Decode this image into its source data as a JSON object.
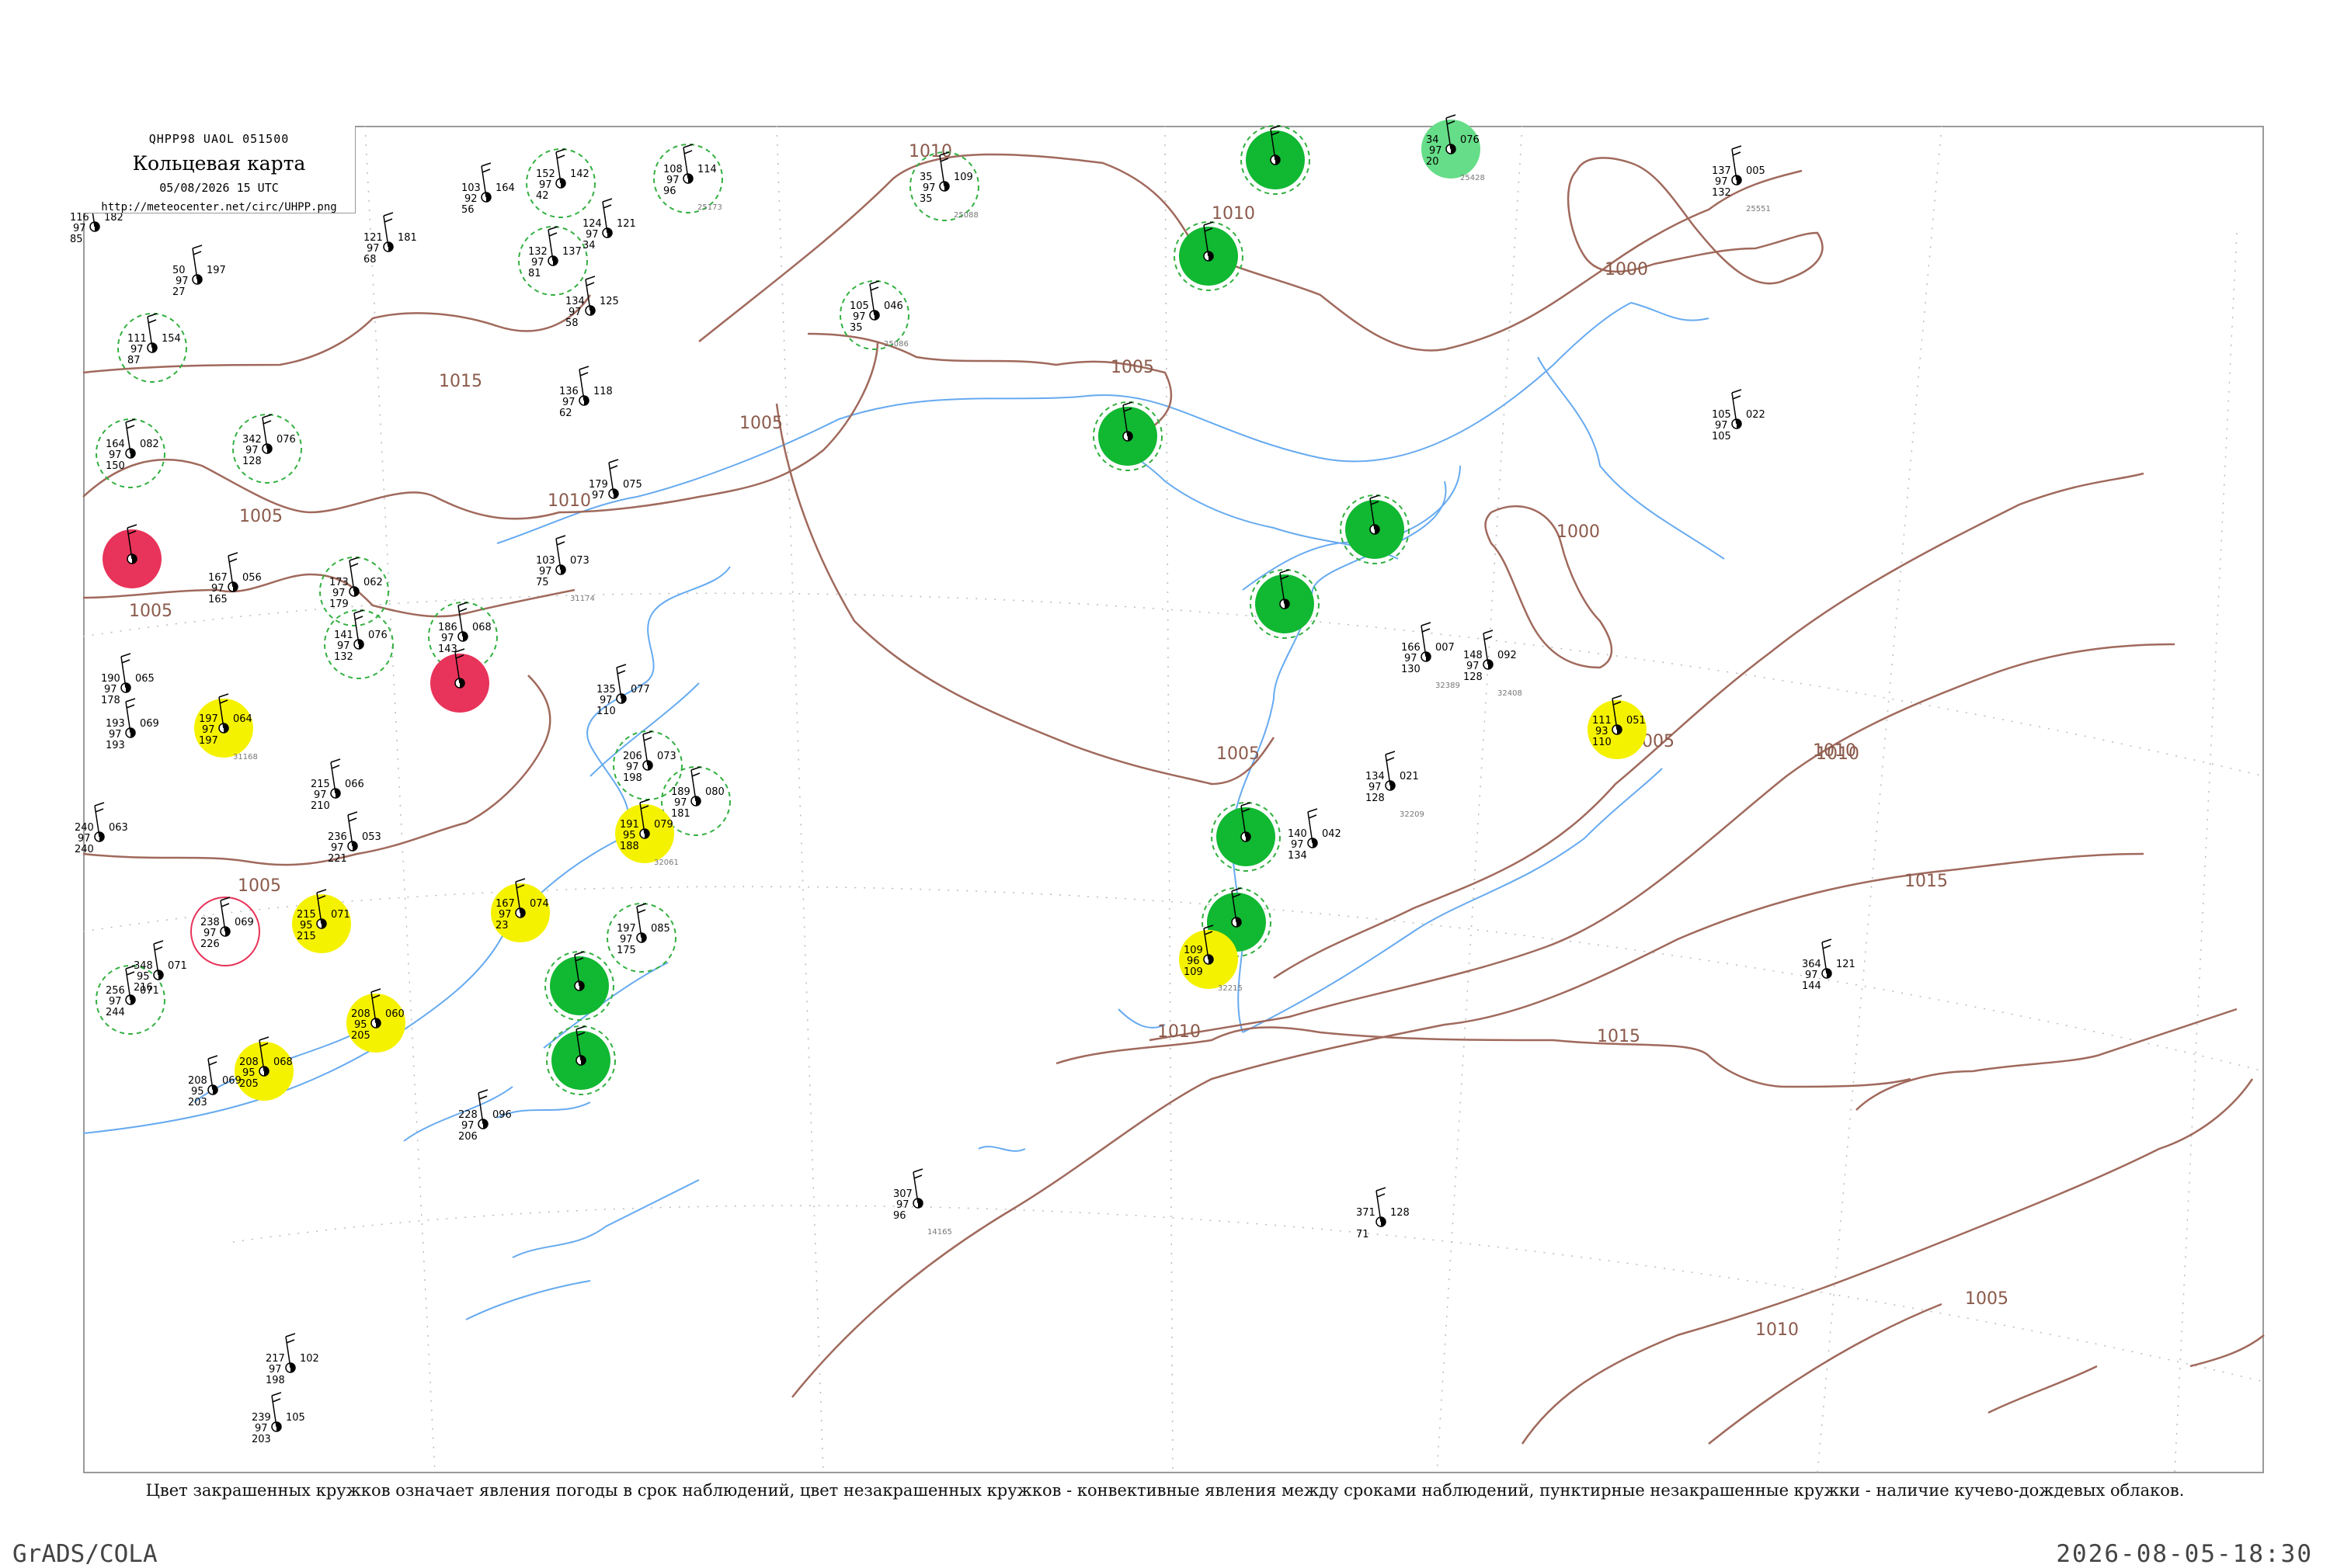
{
  "header": {
    "code": "QHPP98  UAOL  051500",
    "title": "Кольцевая карта",
    "date": "05/08/2026 15 UTC",
    "url": "http://meteocenter.net/circ/UHPP.png"
  },
  "isobars": [
    {
      "label": "1010"
    },
    {
      "label": "1010"
    },
    {
      "label": "1015"
    },
    {
      "label": "1005"
    },
    {
      "label": "1005"
    },
    {
      "label": "1005"
    },
    {
      "label": "1010"
    },
    {
      "label": "1005"
    },
    {
      "label": "1000"
    },
    {
      "label": "1000"
    },
    {
      "label": "1005"
    },
    {
      "label": "1010"
    },
    {
      "label": "1010"
    },
    {
      "label": "1015"
    },
    {
      "label": "1015"
    },
    {
      "label": "1005"
    },
    {
      "label": "1005"
    },
    {
      "label": "1010"
    },
    {
      "label": "1010"
    },
    {
      "label": "1005"
    }
  ],
  "stations": [
    {
      "pressure": "108",
      "temp": "97",
      "dew": "96",
      "extra": "114",
      "id": "25173",
      "circle": "dashed-green"
    },
    {
      "pressure": "35",
      "temp": "97",
      "dew": "35",
      "extra": "109",
      "id": "25088",
      "circle": "dashed-green"
    },
    {
      "pressure": "34",
      "temp": "97",
      "dew": "20",
      "extra": "076",
      "id": "25428",
      "circle": "light-green"
    },
    {
      "pressure": "137",
      "temp": "97",
      "dew": "132",
      "extra": "005",
      "id": "25551",
      "circle": "none"
    },
    {
      "pressure": "105",
      "temp": "97",
      "dew": "35",
      "extra": "046",
      "id": "25086",
      "circle": "dashed-green"
    },
    {
      "pressure": "132",
      "temp": "97",
      "dew": "81",
      "extra": "137",
      "id": "",
      "circle": "dashed-green"
    },
    {
      "pressure": "152",
      "temp": "97",
      "dew": "42",
      "extra": "142",
      "id": "",
      "circle": "dashed-green"
    },
    {
      "pressure": "111",
      "temp": "97",
      "dew": "87",
      "extra": "154",
      "id": "",
      "circle": "dashed-green"
    },
    {
      "pressure": "164",
      "temp": "97",
      "dew": "150",
      "extra": "082",
      "id": "",
      "circle": "dashed-green"
    },
    {
      "pressure": "342",
      "temp": "97",
      "dew": "128",
      "extra": "076",
      "id": "",
      "circle": "dashed-green"
    },
    {
      "pressure": "",
      "temp": "",
      "dew": "",
      "extra": "",
      "id": "",
      "circle": "red"
    },
    {
      "pressure": "173",
      "temp": "97",
      "dew": "179",
      "extra": "062",
      "id": "",
      "circle": "dashed-green"
    },
    {
      "pressure": "141",
      "temp": "97",
      "dew": "132",
      "extra": "076",
      "id": "",
      "circle": "dashed-green"
    },
    {
      "pressure": "186",
      "temp": "97",
      "dew": "143",
      "extra": "068",
      "id": "",
      "circle": "dashed-green"
    },
    {
      "pressure": "",
      "temp": "",
      "dew": "",
      "extra": "",
      "id": "",
      "circle": "red"
    },
    {
      "pressure": "197",
      "temp": "97",
      "dew": "197",
      "extra": "064",
      "id": "31168",
      "circle": "yellow"
    },
    {
      "pressure": "206",
      "temp": "97",
      "dew": "198",
      "extra": "073",
      "id": "",
      "circle": "dashed-green"
    },
    {
      "pressure": "189",
      "temp": "97",
      "dew": "181",
      "extra": "080",
      "id": "",
      "circle": "dashed-green"
    },
    {
      "pressure": "191",
      "temp": "95",
      "dew": "188",
      "extra": "079",
      "id": "32061",
      "circle": "yellow"
    },
    {
      "pressure": "215",
      "temp": "95",
      "dew": "215",
      "extra": "071",
      "id": "",
      "circle": "yellow"
    },
    {
      "pressure": "167",
      "temp": "97",
      "dew": "23",
      "extra": "074",
      "id": "",
      "circle": "yellow"
    },
    {
      "pressure": "197",
      "temp": "97",
      "dew": "175",
      "extra": "085",
      "id": "",
      "circle": "dashed-green"
    },
    {
      "pressure": "238",
      "temp": "97",
      "dew": "226",
      "extra": "069",
      "id": "",
      "circle": "red-outline"
    },
    {
      "pressure": "",
      "temp": "",
      "dew": "",
      "extra": "",
      "id": "",
      "circle": "green"
    },
    {
      "pressure": "",
      "temp": "",
      "dew": "",
      "extra": "",
      "id": "",
      "circle": "green"
    },
    {
      "pressure": "208",
      "temp": "95",
      "dew": "205",
      "extra": "060",
      "id": "",
      "circle": "yellow"
    },
    {
      "pressure": "256",
      "temp": "97",
      "dew": "244",
      "extra": "071",
      "id": "",
      "circle": "dashed-green"
    },
    {
      "pressure": "208",
      "temp": "95",
      "dew": "205",
      "extra": "068",
      "id": "",
      "circle": "yellow"
    },
    {
      "pressure": "",
      "temp": "",
      "dew": "",
      "extra": "",
      "id": "",
      "circle": "green"
    },
    {
      "pressure": "",
      "temp": "",
      "dew": "",
      "extra": "",
      "id": "",
      "circle": "green"
    },
    {
      "pressure": "",
      "temp": "",
      "dew": "",
      "extra": "",
      "id": "",
      "circle": "green"
    },
    {
      "pressure": "",
      "temp": "",
      "dew": "",
      "extra": "",
      "id": "",
      "circle": "green"
    },
    {
      "pressure": "",
      "temp": "",
      "dew": "",
      "extra": "",
      "id": "",
      "circle": "green"
    },
    {
      "pressure": "",
      "temp": "",
      "dew": "",
      "extra": "",
      "id": "",
      "circle": "green"
    },
    {
      "pressure": "",
      "temp": "",
      "dew": "",
      "extra": "",
      "id": "",
      "circle": "green"
    },
    {
      "pressure": "111",
      "temp": "93",
      "dew": "110",
      "extra": "051",
      "id": "",
      "circle": "yellow"
    },
    {
      "pressure": "109",
      "temp": "96",
      "dew": "109",
      "extra": "",
      "id": "32215",
      "circle": "yellow"
    },
    {
      "pressure": "105",
      "temp": "97",
      "dew": "105",
      "extra": "022",
      "id": "",
      "circle": "none"
    },
    {
      "pressure": "166",
      "temp": "97",
      "dew": "130",
      "extra": "007",
      "id": "32389",
      "circle": "none"
    },
    {
      "pressure": "148",
      "temp": "97",
      "dew": "128",
      "extra": "092",
      "id": "32408",
      "circle": "none"
    },
    {
      "pressure": "134",
      "temp": "97",
      "dew": "128",
      "extra": "021",
      "id": "32209",
      "circle": "none"
    },
    {
      "pressure": "140",
      "temp": "97",
      "dew": "134",
      "extra": "042",
      "id": "",
      "circle": "none"
    },
    {
      "pressure": "364",
      "temp": "97",
      "dew": "144",
      "extra": "121",
      "id": "",
      "circle": "none"
    },
    {
      "pressure": "307",
      "temp": "97",
      "dew": "96",
      "extra": "",
      "id": "14165",
      "circle": "none"
    },
    {
      "pressure": "371",
      "temp": "",
      "dew": "71",
      "extra": "128",
      "id": "",
      "circle": "none"
    },
    {
      "pressure": "103",
      "temp": "97",
      "dew": "75",
      "extra": "073",
      "id": "31174",
      "circle": "none"
    },
    {
      "pressure": "179",
      "temp": "97",
      "dew": "",
      "extra": "075",
      "id": "",
      "circle": "none"
    },
    {
      "pressure": "136",
      "temp": "97",
      "dew": "62",
      "extra": "118",
      "id": "",
      "circle": "none"
    },
    {
      "pressure": "134",
      "temp": "97",
      "dew": "58",
      "extra": "125",
      "id": "",
      "circle": "none"
    },
    {
      "pressure": "124",
      "temp": "97",
      "dew": "34",
      "extra": "121",
      "id": "",
      "circle": "none"
    },
    {
      "pressure": "103",
      "temp": "92",
      "dew": "56",
      "extra": "164",
      "id": "",
      "circle": "none"
    },
    {
      "pressure": "121",
      "temp": "97",
      "dew": "68",
      "extra": "181",
      "id": "",
      "circle": "none"
    },
    {
      "pressure": "116",
      "temp": "97",
      "dew": "85",
      "extra": "182",
      "id": "",
      "circle": "none"
    },
    {
      "pressure": "50",
      "temp": "97",
      "dew": "27",
      "extra": "197",
      "id": "",
      "circle": "none"
    },
    {
      "pressure": "167",
      "temp": "97",
      "dew": "165",
      "extra": "056",
      "id": "",
      "circle": "none"
    },
    {
      "pressure": "190",
      "temp": "97",
      "dew": "178",
      "extra": "065",
      "id": "",
      "circle": "none"
    },
    {
      "pressure": "193",
      "temp": "97",
      "dew": "193",
      "extra": "069",
      "id": "",
      "circle": "none"
    },
    {
      "pressure": "240",
      "temp": "97",
      "dew": "240",
      "extra": "063",
      "id": "",
      "circle": "none"
    },
    {
      "pressure": "348",
      "temp": "95",
      "dew": "216",
      "extra": "071",
      "id": "",
      "circle": "none"
    },
    {
      "pressure": "208",
      "temp": "95",
      "dew": "203",
      "extra": "069",
      "id": "",
      "circle": "none"
    },
    {
      "pressure": "215",
      "temp": "97",
      "dew": "210",
      "extra": "066",
      "id": "",
      "circle": "none"
    },
    {
      "pressure": "236",
      "temp": "97",
      "dew": "221",
      "extra": "053",
      "id": "",
      "circle": "none"
    },
    {
      "pressure": "135",
      "temp": "97",
      "dew": "110",
      "extra": "077",
      "id": "",
      "circle": "none"
    },
    {
      "pressure": "228",
      "temp": "97",
      "dew": "206",
      "extra": "096",
      "id": "",
      "circle": "none"
    },
    {
      "pressure": "239",
      "temp": "97",
      "dew": "203",
      "extra": "105",
      "id": "",
      "circle": "none"
    },
    {
      "pressure": "217",
      "temp": "97",
      "dew": "198",
      "extra": "102",
      "id": "",
      "circle": "none"
    }
  ],
  "footnote": "Цвет закрашенных кружков означает явления погоды в срок наблюдений, цвет незакрашенных кружков - конвективные явления между сроками наблюдений, пунктирные незакрашенные кружки - наличие кучево-дождевых облаков.",
  "footer": {
    "left": "GrADS/COLA",
    "right": "2026-08-05-18:30"
  },
  "colors": {
    "isobar": "#a0695c",
    "coast": "#66aaf0",
    "green": "#11b832",
    "light_green": "#66dd88",
    "yellow": "#f5f200",
    "red": "#e8335a",
    "dashed_ring": "#33b040"
  }
}
